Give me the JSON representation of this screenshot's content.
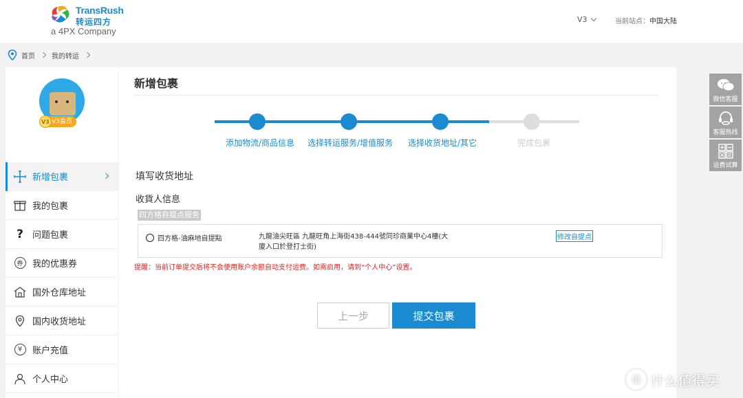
{
  "header": {
    "logo_en": "TransRush",
    "logo_cn": "转运四方",
    "logo_sub": "a 4PX Company",
    "level": "V3",
    "site_label": "当前站点：",
    "site_value": "中国大陆"
  },
  "breadcrumb": {
    "home": "首页",
    "current": "我的转运"
  },
  "user": {
    "badge_icon": "V3",
    "badge_label": "V3会员"
  },
  "sidebar": {
    "items": [
      {
        "label": "新增包裹",
        "icon": "plus-icon"
      },
      {
        "label": "我的包裹",
        "icon": "gift-icon"
      },
      {
        "label": "问题包裹",
        "icon": "question-icon"
      },
      {
        "label": "我的优惠券",
        "icon": "coupon-icon"
      },
      {
        "label": "国外仓库地址",
        "icon": "warehouse-icon"
      },
      {
        "label": "国内收货地址",
        "icon": "location-icon"
      },
      {
        "label": "账户充值",
        "icon": "yen-icon"
      },
      {
        "label": "个人中心",
        "icon": "user-icon"
      }
    ]
  },
  "main": {
    "title": "新增包裹",
    "steps": [
      {
        "label": "添加物流/商品信息",
        "state": "done"
      },
      {
        "label": "选择转运服务/增值服务",
        "state": "done"
      },
      {
        "label": "选择收货地址/其它",
        "state": "current"
      },
      {
        "label": "完成包裹",
        "state": "todo"
      }
    ],
    "section_title": "填写收货地址",
    "sub_title": "收貨人信息",
    "service_tag": "四方格自提点服务",
    "pickup": {
      "name": "四方格-油麻地自提點",
      "address": "九龍油尖旺區 九龍旺角上海街438-444號同珍商業中心4樓(大廈入口於登打士街)",
      "edit": "修改自提点"
    },
    "warning": "提醒：当前订单提交后将不会使用账户余额自动支付运费。如需启用，请到“个人中心”设置。",
    "btn_prev": "上一步",
    "btn_submit": "提交包裹"
  },
  "floatbar": [
    {
      "label": "微信客服",
      "icon": "wechat-icon"
    },
    {
      "label": "客服热线",
      "icon": "headset-icon"
    },
    {
      "label": "运费试算",
      "icon": "calculator-icon"
    }
  ],
  "watermark": "什么值得买",
  "colors": {
    "accent": "#1a8bd0",
    "warning": "#e02020",
    "badge": "#f5a81c"
  }
}
